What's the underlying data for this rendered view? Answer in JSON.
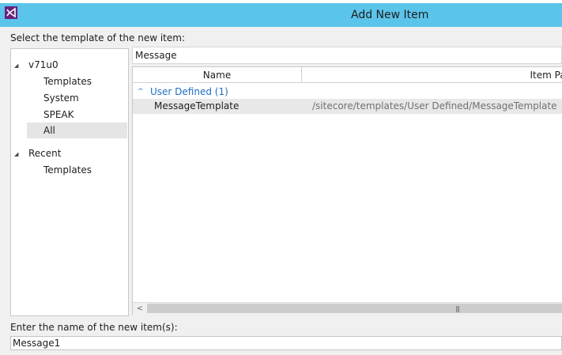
{
  "window": {
    "title": "Add New Item",
    "logo_icon": "visual-studio-logo-icon"
  },
  "template_prompt": "Select the template of the new item:",
  "tree": {
    "nodes": [
      {
        "label": "v71u0",
        "expanded": true
      },
      {
        "label": "Templates"
      },
      {
        "label": "System"
      },
      {
        "label": "SPEAK"
      },
      {
        "label": "All",
        "selected": true
      },
      {
        "label": "Recent",
        "expanded": true
      },
      {
        "label": "Templates"
      }
    ]
  },
  "search": {
    "value": "Message"
  },
  "list": {
    "columns": [
      "Name",
      "Item Path"
    ],
    "groups": [
      {
        "label": "User Defined (1)",
        "items": [
          {
            "name": "MessageTemplate",
            "path": "/sitecore/templates/User Defined/MessageTemplate"
          }
        ]
      }
    ]
  },
  "name_prompt": "Enter the name of the new item(s):",
  "name_input": {
    "value": "Message1"
  },
  "colors": {
    "titlebar": "#5bc4ea",
    "group_link": "#1e6fc4",
    "selected_row": "#e8e8e8"
  }
}
